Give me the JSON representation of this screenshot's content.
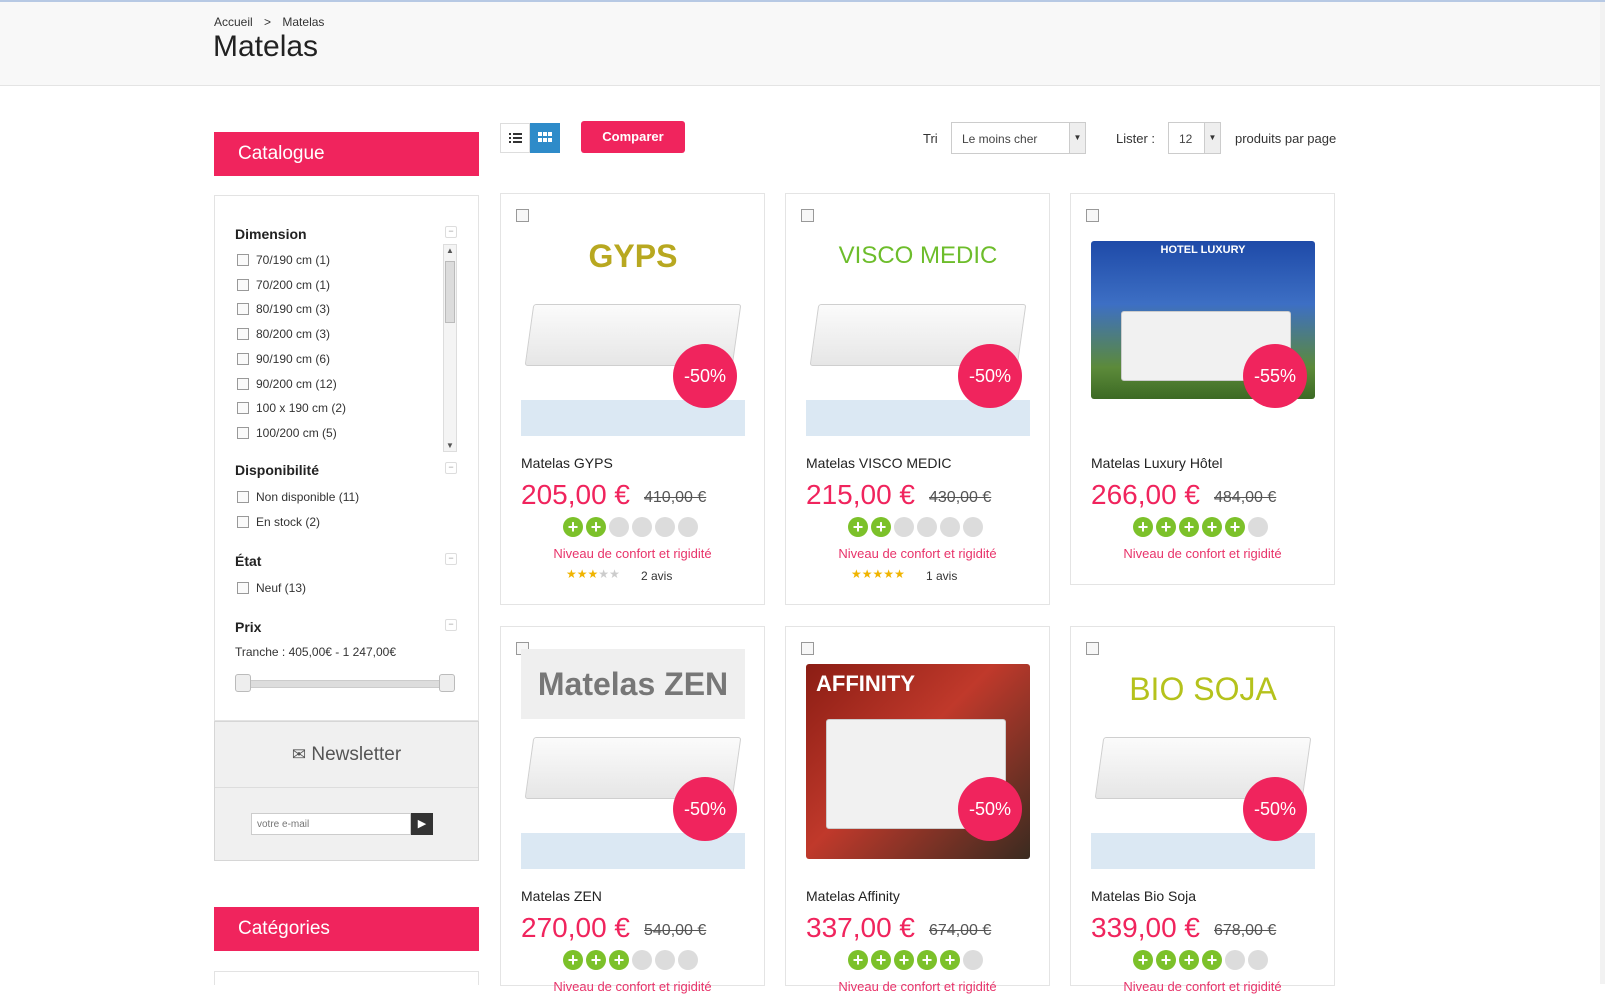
{
  "breadcrumb": {
    "home": "Accueil",
    "sep": ">",
    "current": "Matelas"
  },
  "page_title": "Matelas",
  "sidebar": {
    "catalogue_title": "Catalogue",
    "dimension": {
      "title": "Dimension",
      "options": [
        "70/190 cm (1)",
        "70/200 cm (1)",
        "80/190 cm (3)",
        "80/200 cm (3)",
        "90/190 cm (6)",
        "90/200 cm (12)",
        "100 x 190 cm (2)",
        "100/200 cm (5)"
      ]
    },
    "disponibilite": {
      "title": "Disponibilité",
      "options": [
        "Non disponible (11)",
        "En stock (2)"
      ]
    },
    "etat": {
      "title": "État",
      "options": [
        "Neuf (13)"
      ]
    },
    "prix": {
      "title": "Prix",
      "range_label": "Tranche : 405,00€ - 1 247,00€"
    },
    "collapse_symbol": "−",
    "newsletter": {
      "title": "Newsletter",
      "placeholder": "votre e-mail",
      "submit": "▶"
    },
    "categories_title": "Catégories"
  },
  "toolbar": {
    "compare_label": "Comparer",
    "sort_label": "Tri",
    "sort_value": "Le moins cher",
    "list_label": "Lister :",
    "list_value": "12",
    "per_page_label": "produits par page",
    "select_arrow": "▼"
  },
  "products": [
    {
      "name": "Matelas GYPS",
      "price": "205,00 €",
      "old_price": "410,00 €",
      "discount": "-50%",
      "comfort": 2,
      "comfort_label": "Niveau de confort et rigidité",
      "stars": 3,
      "reviews": "2 avis",
      "image_label": "GYPS",
      "label_color": "#b8a820"
    },
    {
      "name": "Matelas VISCO MEDIC",
      "price": "215,00 €",
      "old_price": "430,00 €",
      "discount": "-50%",
      "comfort": 2,
      "comfort_label": "Niveau de confort et rigidité",
      "stars": 5,
      "reviews": "1 avis",
      "image_label": "VISCO MEDIC",
      "label_color": "#6dbd2b"
    },
    {
      "name": "Matelas Luxury Hôtel",
      "price": "266,00 €",
      "old_price": "484,00 €",
      "discount": "-55%",
      "comfort": 5,
      "comfort_label": "Niveau de confort et rigidité",
      "stars": 0,
      "reviews": "",
      "image_label": "HOTEL LUXURY",
      "label_color": "#ffffff"
    },
    {
      "name": "Matelas ZEN",
      "price": "270,00 €",
      "old_price": "540,00 €",
      "discount": "-50%",
      "comfort": 3,
      "comfort_label": "Niveau de confort et rigidité",
      "stars": 0,
      "reviews": "",
      "image_label": "Matelas ZEN",
      "label_color": "#777777"
    },
    {
      "name": "Matelas Affinity",
      "price": "337,00 €",
      "old_price": "674,00 €",
      "discount": "-50%",
      "comfort": 5,
      "comfort_label": "Niveau de confort et rigidité",
      "stars": 0,
      "reviews": "",
      "image_label": "AFFINITY",
      "label_color": "#ffffff"
    },
    {
      "name": "Matelas Bio Soja",
      "price": "339,00 €",
      "old_price": "678,00 €",
      "discount": "-50%",
      "comfort": 4,
      "comfort_label": "Niveau de confort et rigidité",
      "stars": 0,
      "reviews": "",
      "image_label": "BIO SOJA",
      "label_color": "#b5c21c"
    }
  ],
  "colors": {
    "accent": "#f0245d",
    "comfort_on": "#7cc12a",
    "view_active": "#2e8bc9"
  }
}
